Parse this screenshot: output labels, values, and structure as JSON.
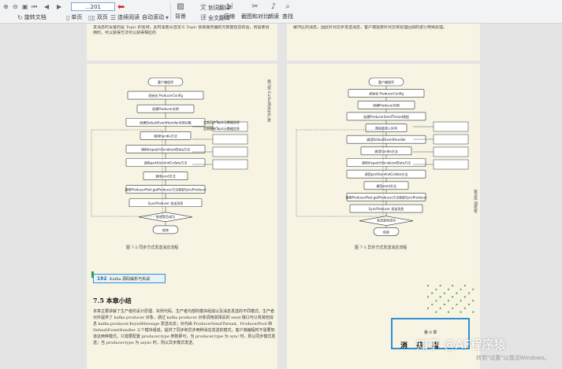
{
  "toolbar": {
    "page_value": "...201",
    "buttons": {
      "rotate": "旋转文档",
      "single": "单页",
      "double": "双页",
      "continuous": "连续阅读",
      "autoscroll": "自动滚动",
      "background": "背景",
      "fulltext_translate": "全文翻译",
      "compress": "压缩",
      "screenshot_compare": "截图和对比",
      "read_aloud": "朗读",
      "search": "查找",
      "zone_translate": "划词翻译"
    },
    "icons": [
      "zoom-in-icon",
      "zoom-out-icon",
      "fit-page-icon",
      "prev-page-icon",
      "next-page-icon",
      "rotate-icon",
      "single-page-icon",
      "double-page-icon",
      "continuous-icon",
      "autoscroll-icon",
      "background-icon",
      "translate-icon",
      "compress-icon",
      "screenshot-icon",
      "read-aloud-icon",
      "search-icon"
    ]
  },
  "pages": {
    "top_left_text": "发消息时设置的是 Topic 的名称，此时需要从自定义 Topic 获取服务器的元数据信息的话，则需要调用时，可以获得方法可以获得相应的",
    "top_right_text": "缓冲区的消息，因此针对异步发送消息，客户端需要针对异常处理回调的进行特殊处理。",
    "left_running_head": "第7章  Kafka消息生产者",
    "right_running_head": "第8章  消费者",
    "left_fig_caption": "图 7-2   同步方式发送消息流程",
    "right_fig_caption": "图 7-3   异步方式发送消息流程",
    "book_header": {
      "page_num": "192",
      "title": "Kafka 源码解析与实战"
    },
    "section_title": "7.5   本章小结",
    "paragraph": "本章主要讲解了生产者的设计原理、实例代码、生产者内部的模块组成以及消息发送的不同模式。生产者对外提供了 kafka producer 对象，通过 kafka producer 对象调用其相关的 send 接口可以将其他消息 kafka.producer.KeyedMessage 发送出去；对内由 ProducerSendThread、ProducerPool 和 DefaultEventHandler 三个模块组成，提供了同步和异步两种消息发送的模式，客户端编程时不需要知道这两种模式，只需要配置 producer.type 参数即可，当 producer.type 为 sync 时，则以同步模式发送；当 producer.type 为 async 时，则以异步模式发送。",
    "chapter": {
      "label": "第 8 章",
      "big": "消  费  者"
    }
  },
  "flow_left": {
    "nodes": [
      "客户端程序",
      "初始化 ProducerConfig",
      "创建Producer实例",
      "创建DefaultEventHandler实例对象",
      "调用handle方法",
      "调用dispatchSerializedData方法",
      "调用partitionAndCollate方法",
      "调用send方法",
      "调用ProducerPool.getProducer方法获取SyncProducer",
      "SyncProducer 发送消息",
      "发送是否成功",
      "结束"
    ],
    "side_notes": [
      "定期同步Topic元数据信息",
      "定期更新Topic元数据信息"
    ]
  },
  "flow_right": {
    "nodes": [
      "客户端程序",
      "初始化 ProducerConfig",
      "创建Producer实例",
      "创建ProducerSendThread线程",
      "将消息放入队列",
      "调用DefaultEventHandler",
      "调用handle方法",
      "调用dispatchSerializedData方法",
      "调用partitionAndCollate方法",
      "调用send方法",
      "调用ProducerPool.getProducer方法获取SyncProducer",
      "SyncProducer 发送消息",
      "发送是否成功",
      "结束"
    ]
  },
  "watermark": "知乎 @AF程序猿",
  "win_note": "转到\"设置\"以激活Windows。"
}
